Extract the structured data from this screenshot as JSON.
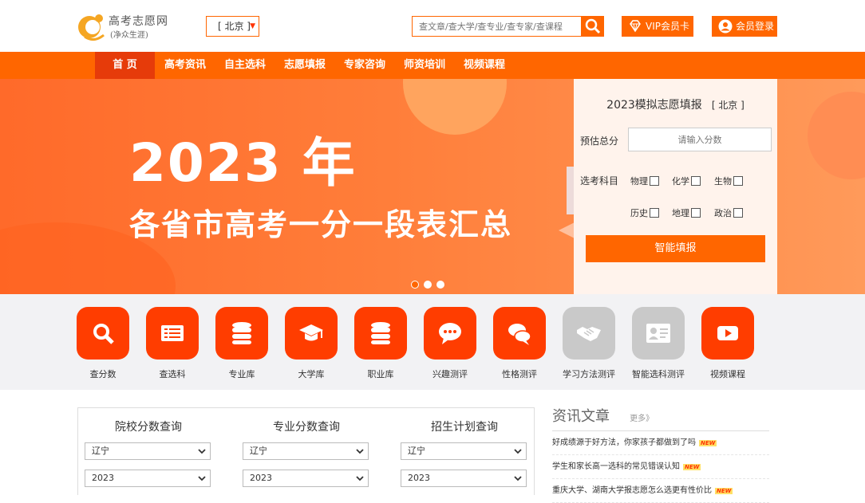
{
  "header": {
    "logo_line1": "高考志愿网",
    "logo_line2": "(净众生涯)",
    "city": "[ 北京 ]",
    "search_placeholder": "查文章/查大学/查专业/查专家/查课程",
    "vip_label": "VIP会员卡",
    "login_label": "会员登录"
  },
  "nav": {
    "items": [
      "首 页",
      "高考资讯",
      "自主选科",
      "志愿填报",
      "专家咨询",
      "师资培训",
      "视频课程"
    ]
  },
  "banner": {
    "headline": "2023 年",
    "subline": "各省市高考一分一段表汇总",
    "slides_total": 3,
    "slide_active": 1
  },
  "panel": {
    "title": "2023模拟志愿填报",
    "city": "[ 北京 ]",
    "score_label": "预估总分",
    "score_placeholder": "请输入分数",
    "subject_label": "选考科目",
    "subjects": [
      "物理",
      "化学",
      "生物",
      "历史",
      "地理",
      "政治"
    ],
    "submit": "智能填报"
  },
  "features": [
    {
      "label": "查分数",
      "icon": "search-icon"
    },
    {
      "label": "查选科",
      "icon": "list-icon"
    },
    {
      "label": "专业库",
      "icon": "database-icon"
    },
    {
      "label": "大学库",
      "icon": "graduation-cap-icon"
    },
    {
      "label": "职业库",
      "icon": "database-icon"
    },
    {
      "label": "兴趣测评",
      "icon": "chat-bubble-icon"
    },
    {
      "label": "性格测评",
      "icon": "chat-bubbles-icon"
    },
    {
      "label": "学习方法测评",
      "icon": "handshake-icon"
    },
    {
      "label": "智能选科测评",
      "icon": "id-card-icon"
    },
    {
      "label": "视频课程",
      "icon": "play-icon"
    }
  ],
  "query": {
    "columns": [
      {
        "title": "院校分数查询",
        "province": "辽宁",
        "year": "2023"
      },
      {
        "title": "专业分数查询",
        "province": "辽宁",
        "year": "2023"
      },
      {
        "title": "招生计划查询",
        "province": "辽宁",
        "year": "2023"
      }
    ]
  },
  "news": {
    "title": "资讯文章",
    "more": "更多》",
    "new_badge": "NEW",
    "items": [
      "好成绩源于好方法，你家孩子都做到了吗",
      "学生和家长高一选科的常见错误认知",
      "重庆大学、湖南大学报志愿怎么选更有性价比"
    ]
  },
  "colors": {
    "accent": "#ff6600",
    "icon_bg": "#ff3d00",
    "icon_disabled": "#c9c9c9"
  }
}
